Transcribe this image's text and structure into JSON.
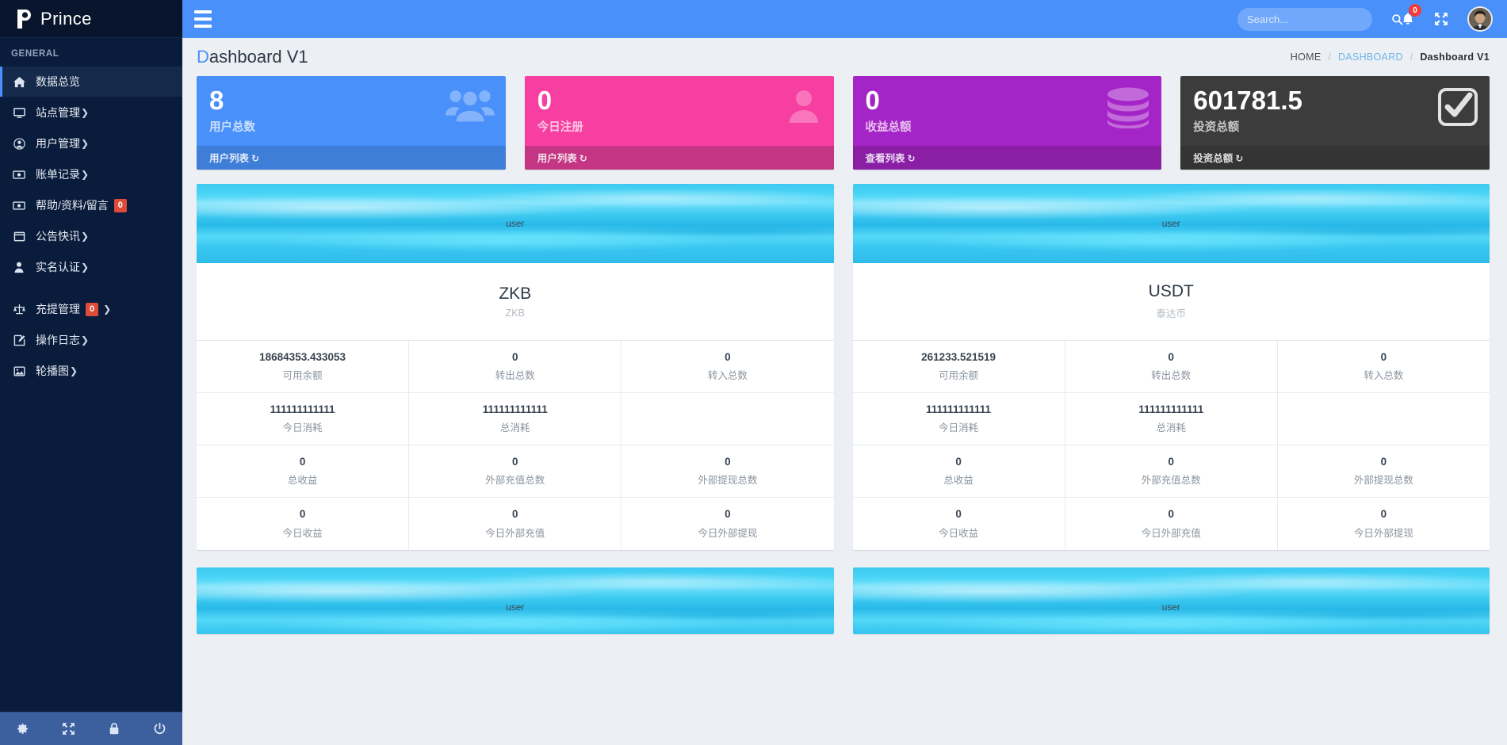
{
  "brand": {
    "name": "Prince",
    "logo_icon": "prince-logo-icon"
  },
  "sidebar": {
    "section_header": "GENERAL",
    "items": [
      {
        "label": "数据总览",
        "icon": "home-icon",
        "caret": "",
        "badge": null,
        "active": true,
        "gap_before": false
      },
      {
        "label": "站点管理",
        "icon": "monitor-icon",
        "caret": "❯",
        "badge": null,
        "active": false,
        "gap_before": false
      },
      {
        "label": "用户管理",
        "icon": "user-circle-icon",
        "caret": "❯",
        "badge": null,
        "active": false,
        "gap_before": false
      },
      {
        "label": "账单记录",
        "icon": "money-icon",
        "caret": "❯",
        "badge": null,
        "active": false,
        "gap_before": false
      },
      {
        "label": "帮助/资料/留言",
        "icon": "money-icon",
        "caret": "",
        "badge": "0",
        "active": false,
        "gap_before": false
      },
      {
        "label": "公告快讯",
        "icon": "window-icon",
        "caret": "❯",
        "badge": null,
        "active": false,
        "gap_before": false
      },
      {
        "label": "实名认证",
        "icon": "person-icon",
        "caret": "❯",
        "badge": null,
        "active": false,
        "gap_before": false
      },
      {
        "label": "充提管理",
        "icon": "balance-icon",
        "caret": "❯",
        "badge": "0",
        "active": false,
        "gap_before": true
      },
      {
        "label": "操作日志",
        "icon": "edit-icon",
        "caret": "❯",
        "badge": null,
        "active": false,
        "gap_before": false
      },
      {
        "label": "轮播图",
        "icon": "image-icon",
        "caret": "❯",
        "badge": null,
        "active": false,
        "gap_before": false
      }
    ],
    "footer_icons": [
      "gear-icon",
      "expand-icon",
      "lock-icon",
      "power-icon"
    ]
  },
  "topbar": {
    "menu_toggle_icon": "hamburger-icon",
    "search": {
      "placeholder": "Search...",
      "value": "",
      "icon": "search-icon"
    },
    "notifications": {
      "icon": "bell-icon",
      "count": "0"
    },
    "fullscreen_icon": "expand-arrows-icon",
    "avatar": "user-avatar"
  },
  "header": {
    "title_first": "D",
    "title_rest": "ashboard V1",
    "breadcrumb": [
      {
        "label": "HOME",
        "type": "plain"
      },
      {
        "label": "DASHBOARD",
        "type": "link"
      },
      {
        "label": "Dashboard V1",
        "type": "current"
      }
    ],
    "breadcrumb_sep": "/"
  },
  "stat_cards": [
    {
      "value": "8",
      "label": "用户总数",
      "footer": "用户列表",
      "icon": "users-group-icon",
      "theme": "sb-blue",
      "arrow": "↻"
    },
    {
      "value": "0",
      "label": "今日注册",
      "footer": "用户列表",
      "icon": "user-single-icon",
      "theme": "sb-pink",
      "arrow": "↻"
    },
    {
      "value": "0",
      "label": "收益总额",
      "footer": "查看列表",
      "icon": "database-icon",
      "theme": "sb-purple",
      "arrow": "↻"
    },
    {
      "value": "601781.5",
      "label": "投资总额",
      "footer": "投资总额",
      "icon": "check-square-icon",
      "theme": "sb-dark",
      "arrow": "↻"
    }
  ],
  "coins": [
    {
      "banner_alt": "user",
      "name": "ZKB",
      "subtitle": "ZKB",
      "rows": [
        [
          {
            "value": "18684353.433053",
            "label": "可用余额"
          },
          {
            "value": "0",
            "label": "转出总数"
          },
          {
            "value": "0",
            "label": "转入总数"
          }
        ],
        [
          {
            "value": "111111111111",
            "label": "今日消耗"
          },
          {
            "value": "111111111111",
            "label": "总消耗"
          },
          {
            "value": "",
            "label": ""
          }
        ],
        [
          {
            "value": "0",
            "label": "总收益"
          },
          {
            "value": "0",
            "label": "外部充值总数"
          },
          {
            "value": "0",
            "label": "外部提现总数"
          }
        ],
        [
          {
            "value": "0",
            "label": "今日收益"
          },
          {
            "value": "0",
            "label": "今日外部充值"
          },
          {
            "value": "0",
            "label": "今日外部提现"
          }
        ]
      ]
    },
    {
      "banner_alt": "user",
      "name": "USDT",
      "subtitle": "泰达币",
      "rows": [
        [
          {
            "value": "261233.521519",
            "label": "可用余额"
          },
          {
            "value": "0",
            "label": "转出总数"
          },
          {
            "value": "0",
            "label": "转入总数"
          }
        ],
        [
          {
            "value": "111111111111",
            "label": "今日消耗"
          },
          {
            "value": "111111111111",
            "label": "总消耗"
          },
          {
            "value": "",
            "label": ""
          }
        ],
        [
          {
            "value": "0",
            "label": "总收益"
          },
          {
            "value": "0",
            "label": "外部充值总数"
          },
          {
            "value": "0",
            "label": "外部提现总数"
          }
        ],
        [
          {
            "value": "0",
            "label": "今日收益"
          },
          {
            "value": "0",
            "label": "今日外部充值"
          },
          {
            "value": "0",
            "label": "今日外部提现"
          }
        ]
      ]
    }
  ],
  "coins_next": [
    {
      "banner_alt": "user"
    },
    {
      "banner_alt": "user"
    }
  ],
  "colors": {
    "sidebar_bg": "#0a1c3b",
    "topbar_blue": "#4990fb",
    "accent_pink": "#f73fa2",
    "accent_purple": "#a524c7",
    "accent_dark": "#3c3c3c",
    "badge_red": "#dd4b39",
    "page_bg": "#ecf0f5"
  }
}
